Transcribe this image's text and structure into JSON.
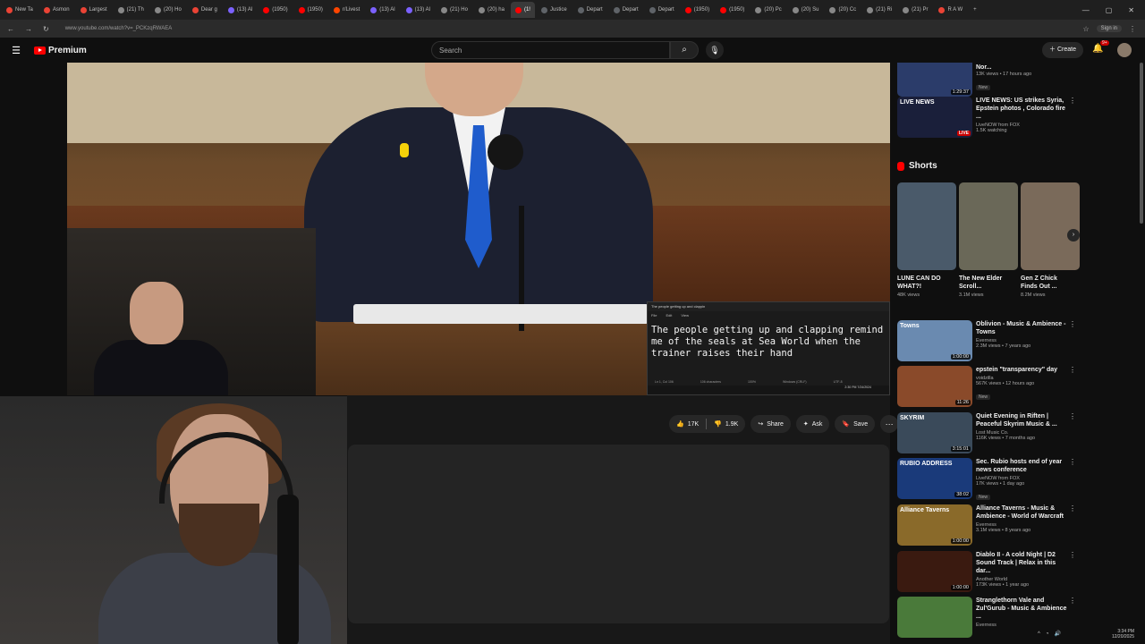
{
  "browser": {
    "tabs": [
      {
        "label": "New Ta",
        "color": "#ea4335"
      },
      {
        "label": "Asmon",
        "color": "#ea4335"
      },
      {
        "label": "Largest",
        "color": "#ea4335"
      },
      {
        "label": "(21) Th",
        "color": "#888888"
      },
      {
        "label": "(20) Ho",
        "color": "#888888"
      },
      {
        "label": "Dear g",
        "color": "#ea4335"
      },
      {
        "label": "(13) Al",
        "color": "#7b61ff"
      },
      {
        "label": "(1950)",
        "color": "#ff0000"
      },
      {
        "label": "(1950)",
        "color": "#ff0000"
      },
      {
        "label": "r/Livest",
        "color": "#ff4500"
      },
      {
        "label": "(13) Al",
        "color": "#7b61ff"
      },
      {
        "label": "(13) Al",
        "color": "#7b61ff"
      },
      {
        "label": "(21) Ho",
        "color": "#888888"
      },
      {
        "label": "(20) ha",
        "color": "#888888"
      },
      {
        "label": "(1!",
        "color": "#ff0000"
      },
      {
        "label": "Justice",
        "color": "#5f6368"
      },
      {
        "label": "Depart",
        "color": "#5f6368"
      },
      {
        "label": "Depart",
        "color": "#5f6368"
      },
      {
        "label": "Depart",
        "color": "#5f6368"
      },
      {
        "label": "(1950)",
        "color": "#ff0000"
      },
      {
        "label": "(1950)",
        "color": "#ff0000"
      },
      {
        "label": "(20) Pc",
        "color": "#888888"
      },
      {
        "label": "(20) Su",
        "color": "#888888"
      },
      {
        "label": "(20) Cc",
        "color": "#888888"
      },
      {
        "label": "(21) Ri",
        "color": "#888888"
      },
      {
        "label": "(21) Pr",
        "color": "#888888"
      },
      {
        "label": "R A W",
        "color": "#ea4335"
      }
    ],
    "active_tab_index": 14,
    "url": "www.youtube.com/watch?v=_PCKzqRWAEA",
    "sign_in": "Sign in"
  },
  "header": {
    "logo": "Premium",
    "search_placeholder": "Search",
    "create": "Create",
    "notif_count": "9+"
  },
  "video": {
    "notepad_title": "The people getting up and clappin",
    "notepad_menu": [
      "File",
      "Edit",
      "View"
    ],
    "notepad_text": "The people getting up and clapping remind\nme of the seals at Sea World when the\ntrainer raises their hand",
    "notepad_status": [
      "Ln 1, Col 106",
      "106 characters",
      "100%",
      "Windows (CRLF)",
      "UTF-8"
    ],
    "notepad_clock": "2:30 PM\n7/24/2024"
  },
  "actions": {
    "likes": "17K",
    "dislikes": "1.9K",
    "share": "Share",
    "ask": "Ask",
    "save": "Save"
  },
  "sidebar": {
    "top_items": [
      {
        "title": "economy in Rocky Mount, Nor...",
        "dur": "1:29:37",
        "views": "13K views • 17 hours ago",
        "channel": "",
        "new": "New",
        "thumb": "#2b3c6a"
      },
      {
        "title": "LIVE NEWS: US strikes Syria, Epstein photos , Colorado fire ...",
        "live": "LIVE",
        "thumb_text": "LIVE NEWS",
        "channel": "LiveNOW from FOX",
        "views": "1.5K watching",
        "thumb": "#1a1f3a"
      }
    ],
    "shorts_label": "Shorts",
    "shorts": [
      {
        "title": "LUNE CAN DO WHAT?!",
        "views": "48K views",
        "color": "#4a5a6a"
      },
      {
        "title": "The New Elder Scroll...",
        "views": "3.1M views",
        "color": "#6a6858"
      },
      {
        "title": "Gen Z Chick Finds Out ...",
        "views": "8.2M views",
        "color": "#7a6a5a"
      }
    ],
    "items": [
      {
        "title": "Oblivion - Music & Ambience - Towns",
        "channel": "Everness",
        "views": "2.3M views • 7 years ago",
        "dur": "1:00:00",
        "thumb": "#6a8ab0",
        "thumb_text": "Towns"
      },
      {
        "title": "epstein \"transparency\" day",
        "channel": "voidzilla",
        "views": "567K views • 12 hours ago",
        "dur": "11:26",
        "new": "New",
        "thumb": "#8a4a2a"
      },
      {
        "title": "Quiet Evening in Riften | Peaceful Skyrim Music & ...",
        "channel": "Lost Music Co.",
        "views": "116K views • 7 months ago",
        "dur": "3:15:01",
        "thumb": "#3a4a5a",
        "thumb_text": "SKYRIM"
      },
      {
        "title": "Sec. Rubio hosts end of year news conference",
        "channel": "LiveNOW from FOX",
        "views": "17K views • 1 day ago",
        "dur": "38:02",
        "new": "New",
        "thumb": "#1a3a7a",
        "thumb_text": "RUBIO ADDRESS"
      },
      {
        "title": "Alliance Taverns - Music & Ambience - World of Warcraft",
        "channel": "Everness",
        "views": "3.1M views • 8 years ago",
        "dur": "1:00:00",
        "thumb": "#8a6a2a",
        "thumb_text": "Alliance Taverns"
      },
      {
        "title": "Diablo II - A cold Night | D2 Sound Track | Relax in this dar...",
        "channel": "Another World",
        "views": "173K views • 1 year ago",
        "dur": "1:00:00",
        "thumb": "#3a1a10"
      },
      {
        "title": "Stranglethorn Vale and Zul'Gurub - Music & Ambience ...",
        "channel": "Everness",
        "views": "",
        "dur": "",
        "thumb": "#4a7a3a"
      }
    ]
  },
  "taskbar": {
    "time": "3:34 PM",
    "date": "12/20/2025"
  }
}
